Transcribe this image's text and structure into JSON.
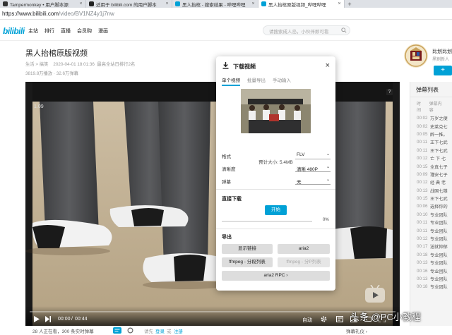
{
  "browser": {
    "tabs": [
      {
        "label": "Tampermonkey • 用户脚本源",
        "favicon_color": "#333333",
        "active": false
      },
      {
        "label": "适用于 bilibili.com 的用户脚本",
        "favicon_color": "#222222",
        "active": false
      },
      {
        "label": "黑人抬棺 - 搜索结果 - 哔哩哔哩",
        "favicon_color": "#00a1d6",
        "active": false
      },
      {
        "label": "黑人抬棺原版视频_哔哩哔哩",
        "favicon_color": "#00a1d6",
        "active": true
      }
    ],
    "new_tab": "+",
    "url_host": "https://www.bilibili.com",
    "url_path": "/video/BV1NZ4y1j7nw"
  },
  "header": {
    "logo": "bilibili",
    "nav": [
      "主站",
      "排行",
      "直播",
      "会员购",
      "漫画"
    ],
    "search_placeholder": "请搜索成人岛，小伙伴即可看"
  },
  "video": {
    "title": "黑人抬棺原版视频",
    "category": "生活 > 搞笑",
    "date": "2020-04-01 18:01:36",
    "rank": "最高全站日排行2名",
    "plays": "3819.8万播放",
    "danmaku_count": "32.6万弹幕"
  },
  "uploader": {
    "name": "比划比划",
    "subtitle": "黑割新人",
    "follow": "+"
  },
  "player": {
    "speed": "1.09",
    "help": "?",
    "time_current": "00:00",
    "time_total": "00:44",
    "quality": "自动",
    "progress": 0
  },
  "danmaku_panel": {
    "title": "弹幕列表",
    "col_time": "时间",
    "col_content": "弹幕内容",
    "rows": [
      {
        "t": "00:02",
        "c": "万岁之便"
      },
      {
        "t": "00:02",
        "c": "史莱克七"
      },
      {
        "t": "00:05",
        "c": "醉一推。"
      },
      {
        "t": "00:11",
        "c": "王下七武"
      },
      {
        "t": "00:11",
        "c": "王下七武"
      },
      {
        "t": "00:12",
        "c": "亡 下 七"
      },
      {
        "t": "00:15",
        "c": "全真七子"
      },
      {
        "t": "00:09",
        "c": "瑾安七子"
      },
      {
        "t": "00:12",
        "c": "经 典 老"
      },
      {
        "t": "00:13",
        "c": "战国七雄"
      },
      {
        "t": "00:15",
        "c": "王下七武"
      },
      {
        "t": "00:06",
        "c": "选择你的"
      },
      {
        "t": "00:10",
        "c": "专业团队"
      },
      {
        "t": "00:11",
        "c": "专业团队"
      },
      {
        "t": "00:11",
        "c": "专业团队"
      },
      {
        "t": "00:12",
        "c": "专业团队"
      },
      {
        "t": "00:17",
        "c": "送就抑郁"
      },
      {
        "t": "00:18",
        "c": "专业团队"
      },
      {
        "t": "00:13",
        "c": "专业团队"
      },
      {
        "t": "00:16",
        "c": "专业团队"
      },
      {
        "t": "00:13",
        "c": "专业团队"
      },
      {
        "t": "00:18",
        "c": "专业团队"
      }
    ]
  },
  "dialog": {
    "title": "下载视频",
    "close": "×",
    "tabs": [
      "单个视频",
      "批量导出",
      "手动输入"
    ],
    "size_label": "预计大小: 5.4MB",
    "fields": [
      {
        "label": "格式",
        "value": "FLV"
      },
      {
        "label": "清晰度",
        "value": "清晰 480P"
      },
      {
        "label": "弹幕",
        "value": "无"
      }
    ],
    "direct_title": "直接下载",
    "start": "开始",
    "percent": "0%",
    "download_progress": 0,
    "export_title": "导出",
    "export_buttons": [
      "显示链接",
      "aria2",
      "ffmpeg - 分段列表",
      "ffmpeg - 分P列表",
      "aria2 RPC  ›"
    ]
  },
  "footer": {
    "watching": "28 人正在看，300 条实时弹幕",
    "login_prefix": "请先",
    "login": "登录",
    "or": "或",
    "register": "注册",
    "etiquette": "弹幕礼仪 ›"
  },
  "watermark": "头条 @PC小教程"
}
